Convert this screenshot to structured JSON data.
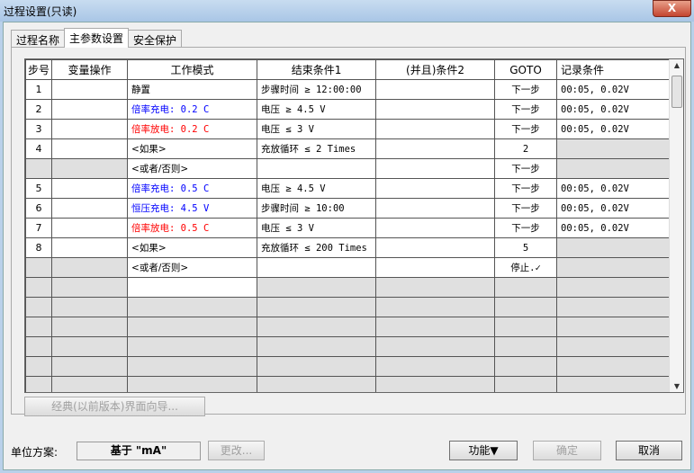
{
  "window": {
    "title": "过程设置(只读)",
    "close": "X"
  },
  "tabs": [
    "过程名称",
    "主参数设置",
    "安全保护"
  ],
  "table": {
    "headers": [
      "步号",
      "变量操作",
      "工作模式",
      "结束条件1",
      "(并且)条件2",
      "GOTO",
      "记录条件"
    ],
    "rows": [
      {
        "step": "1",
        "var": "",
        "mode": "静置",
        "mode_color": "black",
        "end1": "步骤时间 ≥ 12:00:00",
        "end2": "",
        "goto": "下一步",
        "record": "00:05, 0.02V"
      },
      {
        "step": "2",
        "var": "",
        "mode": "倍率充电: 0.2 C",
        "mode_color": "blue",
        "end1": "电压 ≥ 4.5 V",
        "end2": "",
        "goto": "下一步",
        "record": "00:05, 0.02V"
      },
      {
        "step": "3",
        "var": "",
        "mode": "倍率放电: 0.2 C",
        "mode_color": "red",
        "end1": "电压 ≤ 3 V",
        "end2": "",
        "goto": "下一步",
        "record": "00:05, 0.02V"
      },
      {
        "step": "4",
        "var": "",
        "mode": "<如果>",
        "mode_color": "black",
        "end1": "充放循环 ≤ 2 Times",
        "end2": "",
        "goto": "2",
        "record": ""
      },
      {
        "step": "",
        "var": "",
        "mode": "<或者/否则>",
        "mode_color": "black",
        "end1": "",
        "end2": "",
        "goto": "下一步",
        "record": ""
      },
      {
        "step": "5",
        "var": "",
        "mode": "倍率充电: 0.5 C",
        "mode_color": "blue",
        "end1": "电压 ≥ 4.5 V",
        "end2": "",
        "goto": "下一步",
        "record": "00:05, 0.02V"
      },
      {
        "step": "6",
        "var": "",
        "mode": "恒压充电: 4.5 V",
        "mode_color": "blue",
        "end1": "步骤时间 ≥ 10:00",
        "end2": "",
        "goto": "下一步",
        "record": "00:05, 0.02V"
      },
      {
        "step": "7",
        "var": "",
        "mode": "倍率放电: 0.5 C",
        "mode_color": "red",
        "end1": "电压 ≤ 3 V",
        "end2": "",
        "goto": "下一步",
        "record": "00:05, 0.02V"
      },
      {
        "step": "8",
        "var": "",
        "mode": "<如果>",
        "mode_color": "black",
        "end1": "充放循环 ≤ 200 Times",
        "end2": "",
        "goto": "5",
        "record": ""
      },
      {
        "step": "",
        "var": "",
        "mode": "<或者/否则>",
        "mode_color": "black",
        "end1": "",
        "end2": "",
        "goto": "停止.✓",
        "record": ""
      }
    ]
  },
  "wizard_button": "经典(以前版本)界面向导...",
  "footer": {
    "unit_label": "单位方案:",
    "unit_value": "基于 \"mA\"",
    "change": "更改...",
    "function": "功能▼",
    "ok": "确定",
    "cancel": "取消"
  }
}
